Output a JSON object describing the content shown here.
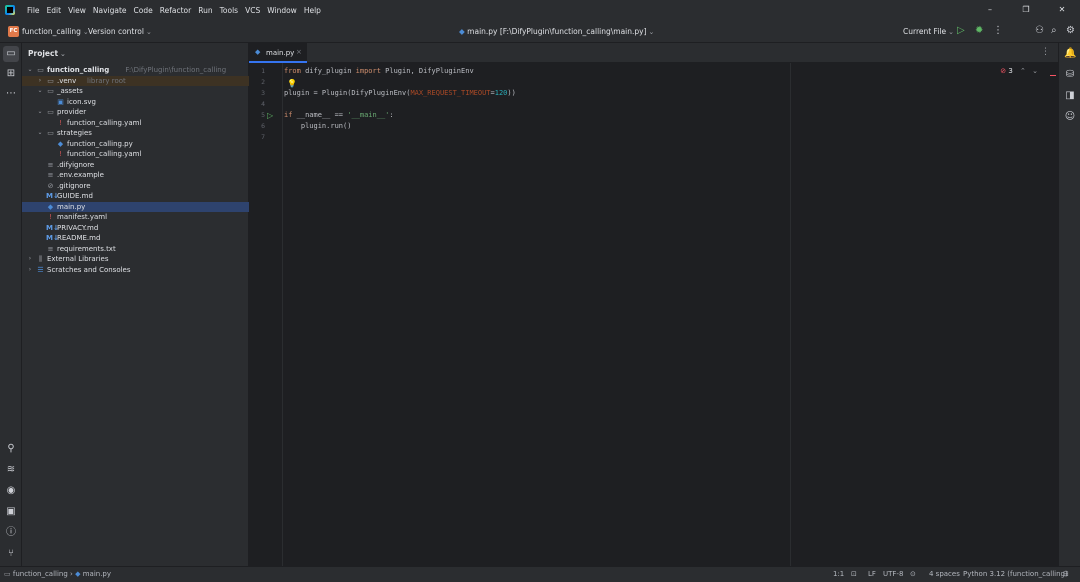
{
  "menu": [
    "File",
    "Edit",
    "View",
    "Navigate",
    "Code",
    "Refactor",
    "Run",
    "Tools",
    "VCS",
    "Window",
    "Help"
  ],
  "window_controls": {
    "minimize": "–",
    "maximize": "❐",
    "close": "✕"
  },
  "toolbar": {
    "project_badge": "FC",
    "project_name": "function_calling",
    "vcs": "Version control",
    "file_title": "main.py [F:\\DifyPlugin\\function_calling\\main.py]",
    "run_config": "Current File"
  },
  "project_panel": {
    "title": "Project",
    "tree": [
      {
        "label": "function_calling",
        "hint": "F:\\DifyPlugin\\function_calling",
        "depth": 0,
        "arrow": "open",
        "icon": "folder",
        "bold": true
      },
      {
        "label": ".venv",
        "hint": "library root",
        "depth": 1,
        "arrow": "closed",
        "icon": "folder",
        "excluded": true
      },
      {
        "label": "_assets",
        "depth": 1,
        "arrow": "open",
        "icon": "folder"
      },
      {
        "label": "icon.svg",
        "depth": 2,
        "icon": "svg"
      },
      {
        "label": "provider",
        "depth": 1,
        "arrow": "open",
        "icon": "folder"
      },
      {
        "label": "function_calling.yaml",
        "depth": 2,
        "icon": "yaml"
      },
      {
        "label": "strategies",
        "depth": 1,
        "arrow": "open",
        "icon": "folder"
      },
      {
        "label": "function_calling.py",
        "depth": 2,
        "icon": "py"
      },
      {
        "label": "function_calling.yaml",
        "depth": 2,
        "icon": "yaml"
      },
      {
        "label": ".difyignore",
        "depth": 1,
        "icon": "txt"
      },
      {
        "label": ".env.example",
        "depth": 1,
        "icon": "txt"
      },
      {
        "label": ".gitignore",
        "depth": 1,
        "icon": "ignore"
      },
      {
        "label": "GUIDE.md",
        "depth": 1,
        "icon": "md"
      },
      {
        "label": "main.py",
        "depth": 1,
        "icon": "py",
        "selected": true
      },
      {
        "label": "manifest.yaml",
        "depth": 1,
        "icon": "yaml"
      },
      {
        "label": "PRIVACY.md",
        "depth": 1,
        "icon": "md"
      },
      {
        "label": "README.md",
        "depth": 1,
        "icon": "md"
      },
      {
        "label": "requirements.txt",
        "depth": 1,
        "icon": "txt"
      },
      {
        "label": "External Libraries",
        "depth": 0,
        "arrow": "closed",
        "icon": "lib"
      },
      {
        "label": "Scratches and Consoles",
        "depth": 0,
        "arrow": "closed",
        "icon": "scratch"
      }
    ]
  },
  "editor": {
    "tab_label": "main.py",
    "error_count": "3",
    "line_numbers": [
      "1",
      "2",
      "3",
      "4",
      "5",
      "6",
      "7"
    ]
  },
  "status": {
    "breadcrumb_project": "function_calling",
    "breadcrumb_file": "main.py",
    "position": "1:1",
    "line_ending": "LF",
    "encoding": "UTF-8",
    "indent": "4 spaces",
    "interpreter": "Python 3.12 (function_calling)"
  },
  "colors": {
    "accent": "#3574f0",
    "error": "#f75464",
    "run": "#5fb865"
  }
}
